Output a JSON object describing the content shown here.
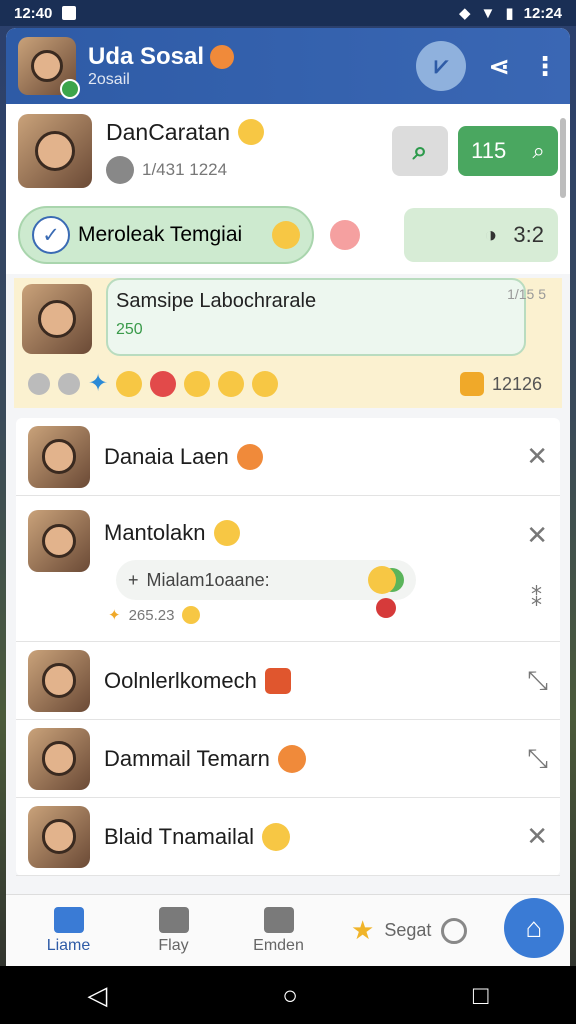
{
  "status_bar": {
    "time": "12:40",
    "right_time": "12:24"
  },
  "header": {
    "title": "Uda Sosal",
    "subtitle": "2osail"
  },
  "profile_card": {
    "name": "DanCaratan",
    "meta": "1/431 1224",
    "search_count": "115"
  },
  "pill": {
    "label": "Meroleak Temgiai",
    "box_time": "3:2"
  },
  "notification": {
    "title": "Samsipe Labochrarale",
    "count_small": "250",
    "side": "1/15 5",
    "total": "12126"
  },
  "contacts": [
    {
      "name": "Danaia Laen"
    },
    {
      "name": "Mantolakn",
      "reply": "Mialam1oaane:",
      "reply_time": "265.23"
    },
    {
      "name": "Oolnlerlkomech"
    },
    {
      "name": "Dammail Temarn"
    },
    {
      "name": "Blaid Tnamailal"
    }
  ],
  "bottom_nav": {
    "home": "Liame",
    "tab2": "Flay",
    "tab3": "Emden",
    "search": "Segat"
  },
  "colors": {
    "primary": "#2e5ba6",
    "accent_green": "#4aa760",
    "notice_bg": "#fbf1d0"
  }
}
